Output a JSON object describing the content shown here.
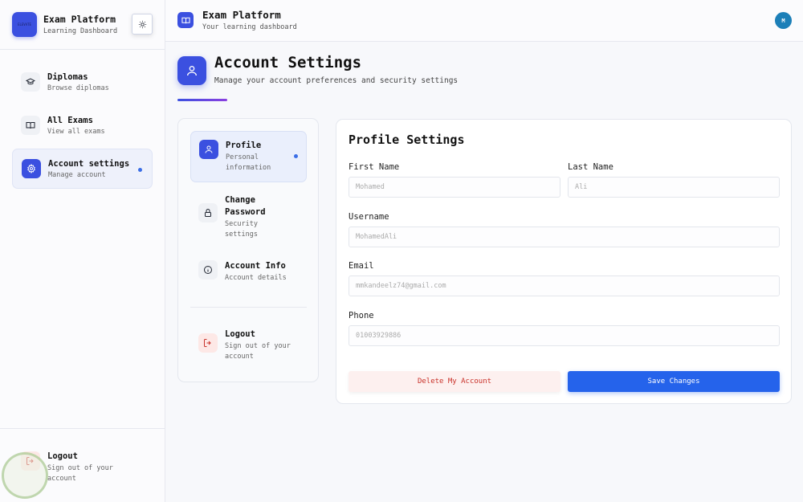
{
  "sidebar": {
    "logo_text": "ELEVATE",
    "brand_title": "Exam Platform",
    "brand_subtitle": "Learning Dashboard",
    "items": [
      {
        "label": "Diplomas",
        "sub": "Browse diplomas",
        "icon": "graduation-cap-icon"
      },
      {
        "label": "All Exams",
        "sub": "View all exams",
        "icon": "book-icon"
      },
      {
        "label": "Account settings",
        "sub": "Manage account",
        "icon": "gear-icon",
        "active": true
      }
    ],
    "logout": {
      "label": "Logout",
      "sub": "Sign out of your account"
    }
  },
  "topbar": {
    "title": "Exam Platform",
    "subtitle": "Your learning dashboard",
    "avatar_initial": "M"
  },
  "page": {
    "title": "Account Settings",
    "subtitle": "Manage your account preferences and security settings"
  },
  "settings_menu": {
    "items": [
      {
        "label": "Profile",
        "sub": "Personal information",
        "icon": "user-icon",
        "active": true
      },
      {
        "label": "Change Password",
        "sub": "Security settings",
        "icon": "lock-icon"
      },
      {
        "label": "Account Info",
        "sub": "Account details",
        "icon": "info-icon"
      }
    ],
    "logout": {
      "label": "Logout",
      "sub": "Sign out of your account",
      "icon": "logout-icon"
    }
  },
  "profile_form": {
    "title": "Profile Settings",
    "first_name": {
      "label": "First Name",
      "placeholder": "Mohamed"
    },
    "last_name": {
      "label": "Last Name",
      "placeholder": "Ali"
    },
    "username": {
      "label": "Username",
      "placeholder": "MohamedAli"
    },
    "email": {
      "label": "Email",
      "placeholder": "mmkandeelz74@gmail.com"
    },
    "phone": {
      "label": "Phone",
      "placeholder": "01003929886"
    },
    "delete_label": "Delete My Account",
    "save_label": "Save Changes"
  },
  "colors": {
    "accent": "#3b50e0",
    "primary_button": "#2563eb",
    "danger_text": "#c9322a",
    "danger_bg": "#fdf0ef"
  }
}
